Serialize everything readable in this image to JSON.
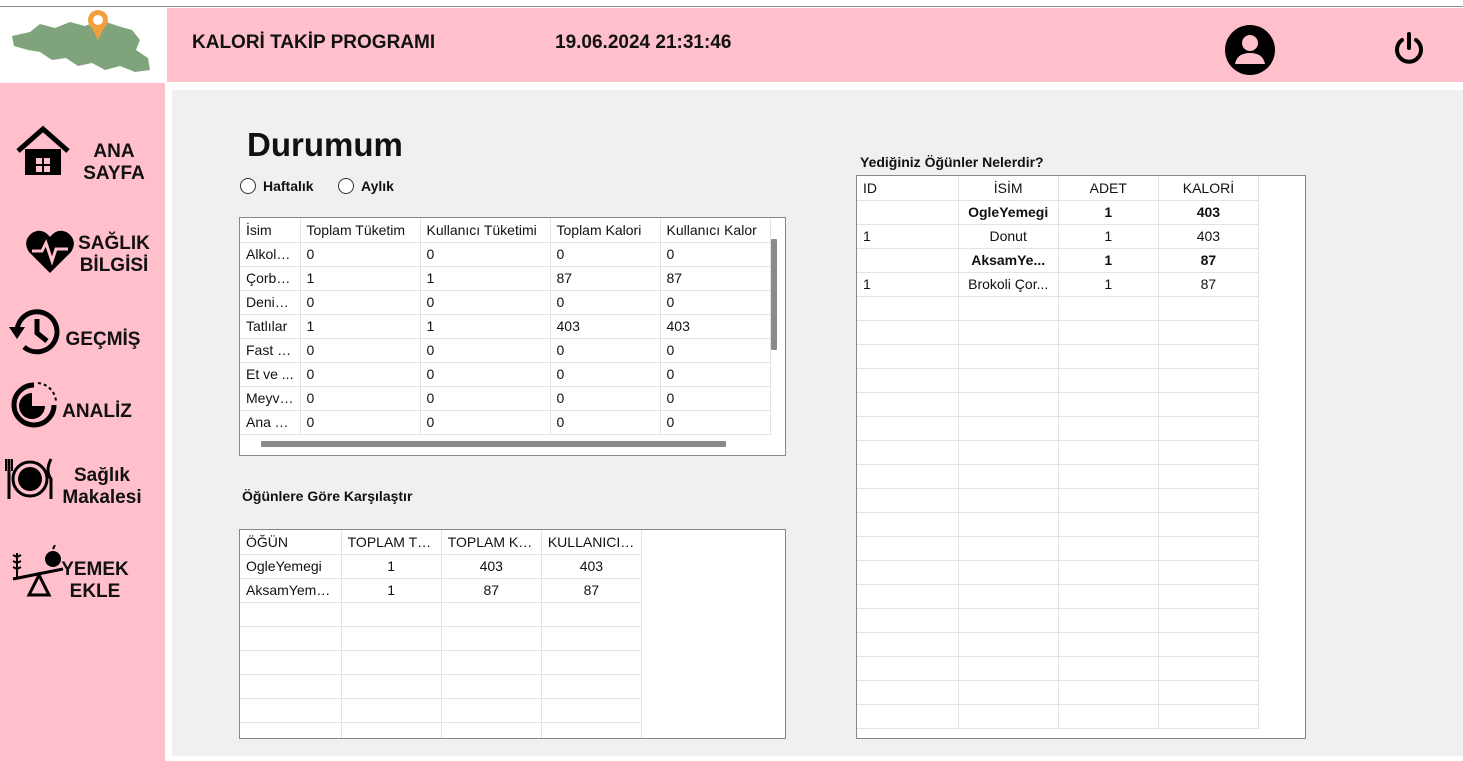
{
  "header": {
    "title": "KALORİ TAKİP PROGRAMI",
    "datetime": "19.06.2024 21:31:46",
    "bg_color": "#ffc0cb",
    "logo_icon": "map-pin-logo-icon",
    "profile_icon": "user-profile-icon",
    "power_icon": "power-icon"
  },
  "sidebar": {
    "items": [
      {
        "label": "ANA\nSAYFA",
        "icon": "home-icon"
      },
      {
        "label": "SAĞLIK\nBİLGİSİ",
        "icon": "heart-pulse-icon"
      },
      {
        "label": "GEÇMİŞ",
        "icon": "history-icon"
      },
      {
        "label": "ANALİZ",
        "icon": "pie-chart-icon"
      },
      {
        "label": "Sağlık\nMakalesi",
        "icon": "dinner-plate-icon"
      },
      {
        "label": "YEMEK\nEKLE",
        "icon": "food-scale-icon"
      }
    ]
  },
  "main": {
    "page_title": "Durumum",
    "radio_weekly": "Haftalık",
    "radio_monthly": "Aylık",
    "category_table": {
      "headers": [
        "İsim",
        "Toplam Tüketim",
        "Kullanıcı Tüketimi",
        "Toplam Kalori",
        "Kullanıcı Kalor"
      ],
      "rows": [
        [
          "Alkols...",
          "0",
          "0",
          "0",
          "0"
        ],
        [
          "Çorba...",
          "1",
          "1",
          "87",
          "87"
        ],
        [
          "Deniz ...",
          "0",
          "0",
          "0",
          "0"
        ],
        [
          "Tatlılar",
          "1",
          "1",
          "403",
          "403"
        ],
        [
          "Fast F...",
          "0",
          "0",
          "0",
          "0"
        ],
        [
          "Et ve ...",
          "0",
          "0",
          "0",
          "0"
        ],
        [
          "Meyve...",
          "0",
          "0",
          "0",
          "0"
        ],
        [
          "Ana Y...",
          "0",
          "0",
          "0",
          "0"
        ]
      ]
    },
    "compare_title": "Öğünlere Göre Karşılaştır",
    "compare_table": {
      "headers": [
        "ÖĞÜN",
        "TOPLAM TÜ...",
        "TOPLAM KA...",
        "KULLANICI ..."
      ],
      "rows": [
        [
          "OgleYemegi",
          "1",
          "403",
          "403"
        ],
        [
          "AksamYeme...",
          "1",
          "87",
          "87"
        ]
      ]
    },
    "meals_title": "Yediğiniz Öğünler Nelerdir?",
    "meals_table": {
      "headers": [
        "ID",
        "İSİM",
        "ADET",
        "KALORİ"
      ],
      "rows": [
        [
          "",
          "OgleYemegi",
          "1",
          "403"
        ],
        [
          "1",
          "Donut",
          "1",
          "403"
        ],
        [
          "",
          "AksamYe...",
          "1",
          "87"
        ],
        [
          "1",
          "Brokoli Çor...",
          "1",
          "87"
        ]
      ]
    }
  }
}
